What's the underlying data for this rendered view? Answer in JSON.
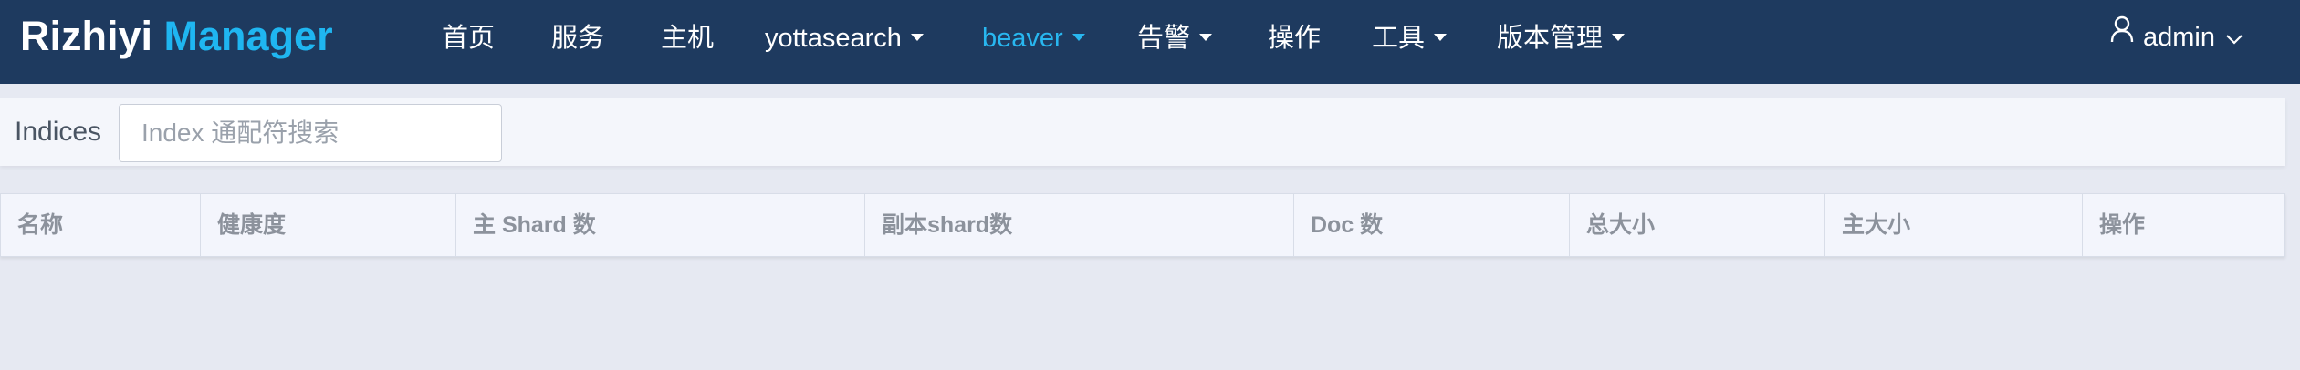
{
  "brand": {
    "part1": "Rizhiyi",
    "part2": "Manager"
  },
  "nav": [
    {
      "label": "首页",
      "dropdown": false,
      "active": false
    },
    {
      "label": "服务",
      "dropdown": false,
      "active": false
    },
    {
      "label": "主机",
      "dropdown": false,
      "active": false
    },
    {
      "label": "yottasearch",
      "dropdown": true,
      "active": false
    },
    {
      "label": "beaver",
      "dropdown": true,
      "active": true
    },
    {
      "label": "告警",
      "dropdown": true,
      "active": false
    },
    {
      "label": "操作",
      "dropdown": false,
      "active": false
    },
    {
      "label": "工具",
      "dropdown": true,
      "active": false
    },
    {
      "label": "版本管理",
      "dropdown": true,
      "active": false
    }
  ],
  "user": {
    "name": "admin",
    "icon": "user-icon"
  },
  "search": {
    "label": "Indices",
    "placeholder": "Index 通配符搜索",
    "value": ""
  },
  "table": {
    "columns": [
      "名称",
      "健康度",
      "主 Shard 数",
      "副本shard数",
      "Doc 数",
      "总大小",
      "主大小",
      "操作"
    ],
    "rows": []
  },
  "colors": {
    "navbar": "#1e3a5f",
    "brand_accent": "#1fb6f1",
    "active_nav": "#28b7f0",
    "page_bg": "#e6e9f2"
  }
}
